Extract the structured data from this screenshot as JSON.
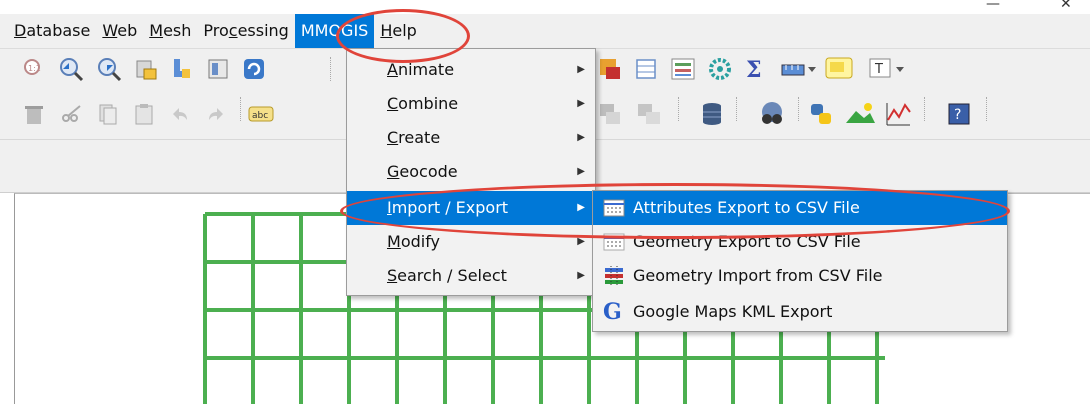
{
  "window": {
    "minimize_glyph": "—",
    "close_glyph": "✕"
  },
  "menubar": {
    "items": [
      {
        "pre": "",
        "u": "D",
        "post": "atabase"
      },
      {
        "pre": "",
        "u": "W",
        "post": "eb"
      },
      {
        "pre": "",
        "u": "M",
        "post": "esh"
      },
      {
        "pre": "Pro",
        "u": "c",
        "post": "essing"
      },
      {
        "pre": "MMQGIS",
        "u": "",
        "post": ""
      },
      {
        "pre": "",
        "u": "H",
        "post": "elp"
      }
    ]
  },
  "toolbar": {
    "icons": [
      "info-zoom-icon",
      "zoom-in-icon",
      "zoom-out-icon",
      "layer-add-icon",
      "layer-edit-icon",
      "open-map-icon",
      "refresh-icon",
      "attribute-table-icon",
      "table-icon",
      "calculator-icon",
      "settings-gear-icon",
      "sigma-stats-icon",
      "measure-icon",
      "python-console-icon",
      "text-annotation-icon"
    ],
    "icons2": [
      "delete-icon",
      "cut-icon",
      "copy-icon",
      "paste-icon",
      "undo-icon",
      "redo-icon",
      "label-abc-icon",
      "label-tool-icon",
      "label-move-icon",
      "database-icon",
      "globe-icon",
      "python-icon",
      "landscape-icon",
      "chart-line-icon",
      "help-icon"
    ]
  },
  "mmqgis_menu": {
    "items": [
      {
        "pre": "",
        "u": "A",
        "post": "nimate"
      },
      {
        "pre": "",
        "u": "C",
        "post": "ombine"
      },
      {
        "pre": "",
        "u": "C",
        "post": "reate"
      },
      {
        "pre": "",
        "u": "G",
        "post": "eocode"
      },
      {
        "pre": "",
        "u": "I",
        "post": "mport / Export"
      },
      {
        "pre": "",
        "u": "M",
        "post": "odify"
      },
      {
        "pre": "",
        "u": "S",
        "post": "earch / Select"
      }
    ],
    "arrow": "▶"
  },
  "submenu": {
    "items": [
      {
        "label": "Attributes Export to CSV File",
        "icon": "csv-table-icon"
      },
      {
        "label": "Geometry Export to CSV File",
        "icon": "csv-table-icon"
      },
      {
        "label": "Geometry Import from CSV File",
        "icon": "csv-import-icon"
      },
      {
        "label": "Google Maps KML Export",
        "icon": "google-g-icon"
      }
    ],
    "google_glyph": "G"
  },
  "colors": {
    "accent": "#0078d7",
    "highlight": "#e0443a",
    "grid": "#4caf50"
  }
}
